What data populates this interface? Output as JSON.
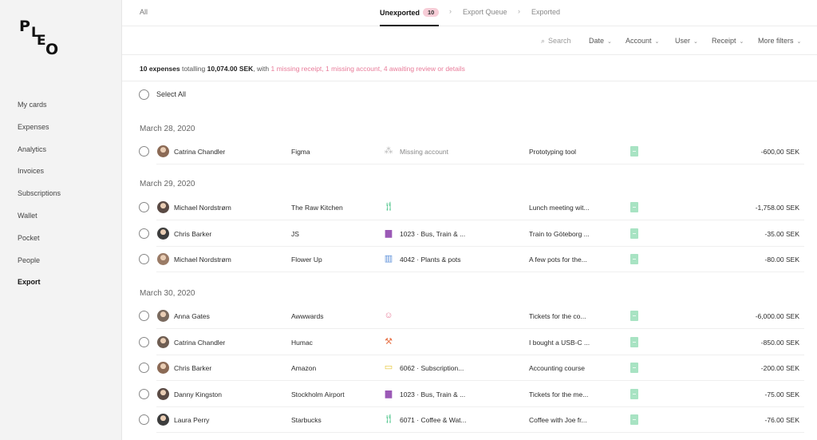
{
  "logo": {
    "letters": [
      "P",
      "L",
      "E",
      "O"
    ]
  },
  "sidebar": {
    "items": [
      {
        "label": "My cards"
      },
      {
        "label": "Expenses"
      },
      {
        "label": "Analytics"
      },
      {
        "label": "Invoices"
      },
      {
        "label": "Subscriptions"
      },
      {
        "label": "Wallet"
      },
      {
        "label": "Pocket"
      },
      {
        "label": "People"
      },
      {
        "label": "Export",
        "active": true
      }
    ]
  },
  "tabs": {
    "all": "All",
    "unexported": "Unexported",
    "unexported_count": "10",
    "export_queue": "Export Queue",
    "exported": "Exported",
    "separator": "›"
  },
  "filters": {
    "search_placeholder": "Search",
    "date": "Date",
    "account": "Account",
    "user": "User",
    "receipt": "Receipt",
    "more": "More filters"
  },
  "summary": {
    "count": "10 expenses",
    "totalling": "totalling",
    "total": "10,074.00 SEK",
    "with": ", with",
    "missing_receipt": "1 missing receipt",
    "missing_account": "1 missing account",
    "awaiting": "4 awaiting review or details",
    "comma": ","
  },
  "select_all": "Select All",
  "colors": {
    "accent_pink": "#e87b99",
    "badge_pink": "#f7cdd7",
    "receipt_green": "#a8e3c3"
  },
  "groups": [
    {
      "date": "March 28, 2020",
      "rows": [
        {
          "user": "Catrina Chandler",
          "merchant": "Figma",
          "icon": "sitemap-icon",
          "icon_glyph": "⁂",
          "icon_color": "#b8b8b8",
          "account": "Missing account",
          "missing": true,
          "note": "Prototyping tool",
          "amount": "-600,00 SEK"
        }
      ]
    },
    {
      "date": "March 29, 2020",
      "rows": [
        {
          "user": "Michael Nordstrøm",
          "merchant": "The Raw Kitchen",
          "icon": "fork-knife-icon",
          "icon_glyph": "🍴︎",
          "icon_color": "#4cc48a",
          "account": "",
          "missing": false,
          "note": "Lunch meeting wit...",
          "amount": "-1,758.00 SEK"
        },
        {
          "user": "Chris Barker",
          "merchant": "JS",
          "icon": "briefcase-icon",
          "icon_glyph": "▆",
          "icon_color": "#9b59b6",
          "account": "1023 · Bus, Train & ...",
          "missing": false,
          "note": "Train to Göteborg ...",
          "amount": "-35.00 SEK"
        },
        {
          "user": "Michael Nordstrøm",
          "merchant": "Flower Up",
          "icon": "building-icon",
          "icon_glyph": "▥",
          "icon_color": "#5b8fd9",
          "account": "4042 · Plants & pots",
          "missing": false,
          "note": "A few pots for the...",
          "amount": "-80.00 SEK"
        }
      ]
    },
    {
      "date": "March 30, 2020",
      "rows": [
        {
          "user": "Anna Gates",
          "merchant": "Awwwards",
          "icon": "smiley-icon",
          "icon_glyph": "☺",
          "icon_color": "#e87b99",
          "account": "",
          "missing": false,
          "note": "Tickets for the co...",
          "amount": "-6,000.00 SEK"
        },
        {
          "user": "Catrina Chandler",
          "merchant": "Humac",
          "icon": "wrench-icon",
          "icon_glyph": "⚒",
          "icon_color": "#e8764c",
          "account": "",
          "missing": false,
          "note": "I bought a USB-C ...",
          "amount": "-850.00 SEK"
        },
        {
          "user": "Chris Barker",
          "merchant": "Amazon",
          "icon": "folder-icon",
          "icon_glyph": "▭",
          "icon_color": "#e6c63a",
          "account": "6062 · Subscription...",
          "missing": false,
          "note": "Accounting course",
          "amount": "-200.00 SEK"
        },
        {
          "user": "Danny Kingston",
          "merchant": "Stockholm Airport",
          "icon": "briefcase-icon",
          "icon_glyph": "▆",
          "icon_color": "#9b59b6",
          "account": "1023 · Bus, Train & ...",
          "missing": false,
          "note": "Tickets for the me...",
          "amount": "-75.00 SEK"
        },
        {
          "user": "Laura Perry",
          "merchant": "Starbucks",
          "icon": "fork-knife-icon",
          "icon_glyph": "🍴︎",
          "icon_color": "#4cc48a",
          "account": "6071 · Coffee & Wat...",
          "missing": false,
          "note": "Coffee with Joe fr...",
          "amount": "-76.00 SEK"
        }
      ]
    }
  ]
}
